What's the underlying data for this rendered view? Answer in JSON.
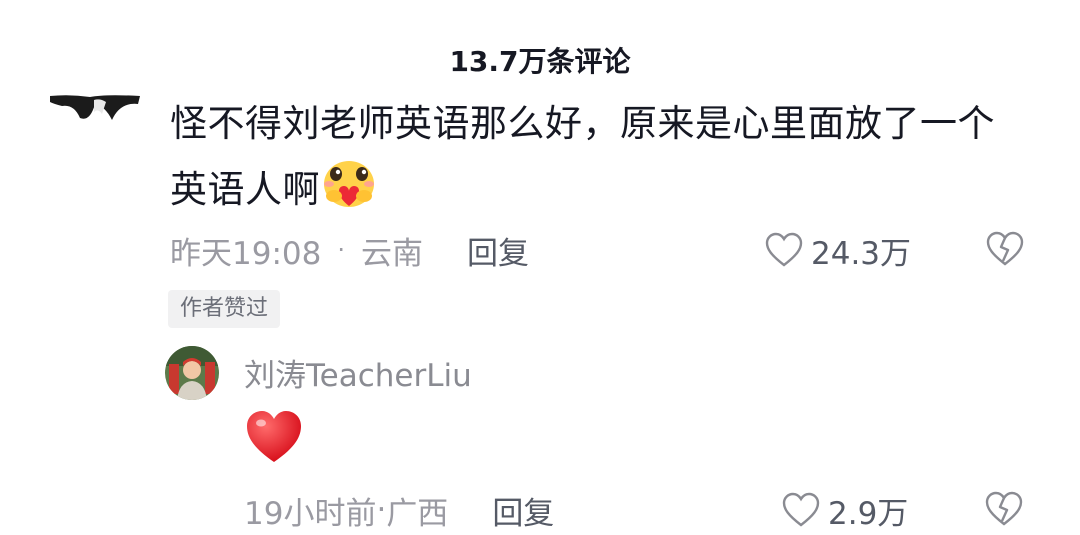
{
  "header": {
    "title": "13.7万条评论"
  },
  "comment": {
    "text": "怪不得刘老师英语那么好，原来是心里面放了一个英语人啊",
    "emoji": "hugging-heart-emoji",
    "time": "昨天19:08",
    "location": "云南",
    "reply_label": "回复",
    "likes": "24.3万",
    "author_liked_badge": "作者赞过"
  },
  "reply": {
    "username": "刘涛TeacherLiu",
    "content_emoji": "red-heart-emoji",
    "time": "19小时前",
    "location": "广西",
    "reply_label": "回复",
    "likes": "2.9万"
  },
  "colors": {
    "text_primary": "#161823",
    "text_secondary": "#9a9aa2",
    "badge_bg": "#f1f1f2",
    "heart_red": "#e8202e"
  }
}
